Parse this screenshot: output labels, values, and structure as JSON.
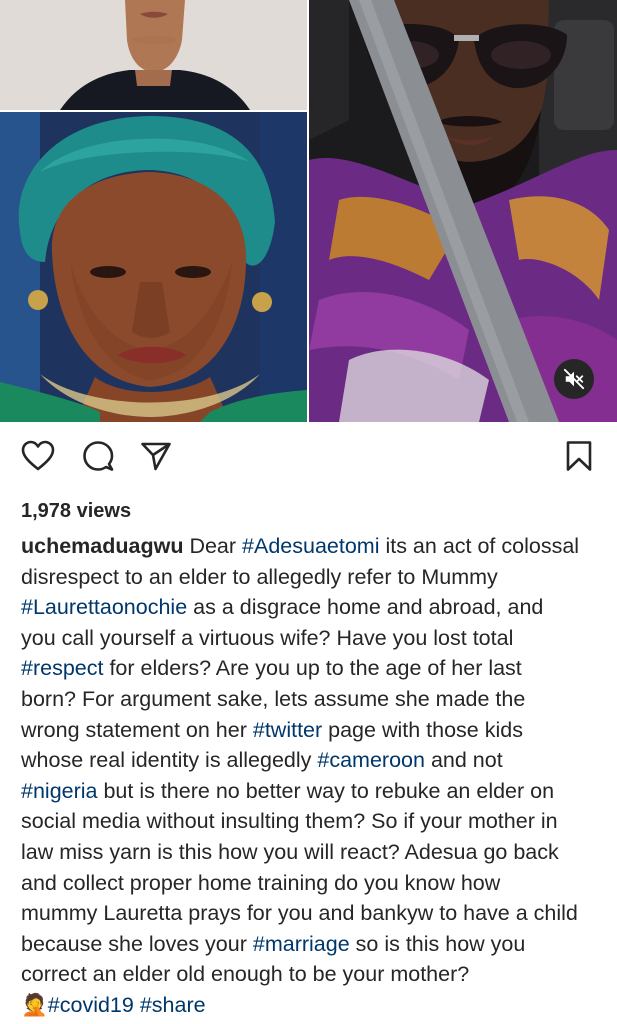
{
  "media": {
    "mute_icon": "speaker-muted-icon",
    "panels": [
      "photo-top-left-woman",
      "photo-bottom-left-elder-woman",
      "video-right-man-in-car"
    ]
  },
  "actions": {
    "like_icon": "heart-icon",
    "comment_icon": "comment-icon",
    "share_icon": "paper-plane-icon",
    "save_icon": "bookmark-icon"
  },
  "post": {
    "views": "1,978 views",
    "username": "uchemaduagwu",
    "caption_lines": [
      [
        {
          "t": "Dear ",
          "k": "text"
        },
        {
          "t": "#Adesuaetomi",
          "k": "tag"
        },
        {
          "t": " its an act of colossal",
          "k": "text"
        }
      ],
      [
        {
          "t": "disrespect to an elder to allegedly refer to Mummy",
          "k": "text"
        }
      ],
      [
        {
          "t": "#Laurettaonochie",
          "k": "tag"
        },
        {
          "t": " as a disgrace home and abroad, and",
          "k": "text"
        }
      ],
      [
        {
          "t": "you call yourself a virtuous wife? Have you lost total",
          "k": "text"
        }
      ],
      [
        {
          "t": "#respect",
          "k": "tag"
        },
        {
          "t": " for elders? Are you up to the age of her last",
          "k": "text"
        }
      ],
      [
        {
          "t": "born? For argument sake, lets assume she made the",
          "k": "text"
        }
      ],
      [
        {
          "t": "wrong statement on her ",
          "k": "text"
        },
        {
          "t": "#twitter",
          "k": "tag"
        },
        {
          "t": " page with those kids",
          "k": "text"
        }
      ],
      [
        {
          "t": "whose real identity is allegedly ",
          "k": "text"
        },
        {
          "t": "#cameroon",
          "k": "tag"
        },
        {
          "t": " and not",
          "k": "text"
        }
      ],
      [
        {
          "t": "#nigeria",
          "k": "tag"
        },
        {
          "t": " but is there no better way to rebuke an elder on",
          "k": "text"
        }
      ],
      [
        {
          "t": "social media without insulting them? So if your mother in",
          "k": "text"
        }
      ],
      [
        {
          "t": "law miss yarn is this how you will react? Adesua go back",
          "k": "text"
        }
      ],
      [
        {
          "t": "and collect proper home training do you know how",
          "k": "text"
        }
      ],
      [
        {
          "t": "mummy Lauretta prays for you and bankyw to have a child",
          "k": "text"
        }
      ],
      [
        {
          "t": "because she loves your ",
          "k": "text"
        },
        {
          "t": "#marriage",
          "k": "tag"
        },
        {
          "t": " so is this how you",
          "k": "text"
        }
      ],
      [
        {
          "t": "correct an elder old enough to be your mother?",
          "k": "text"
        }
      ],
      [
        {
          "t": "🤦",
          "k": "emoji"
        },
        {
          "t": "#covid19",
          "k": "tag"
        },
        {
          "t": " ",
          "k": "text"
        },
        {
          "t": "#share",
          "k": "tag"
        }
      ]
    ]
  },
  "colors": {
    "text": "#262626",
    "hashtag": "#00376b",
    "icon": "#262626",
    "background": "#ffffff"
  }
}
